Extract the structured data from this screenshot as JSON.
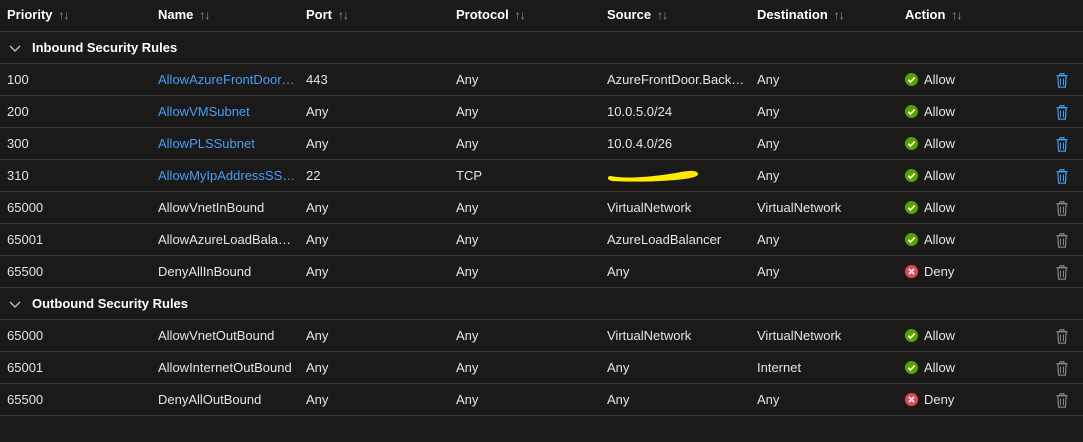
{
  "columns": {
    "priority": "Priority",
    "name": "Name",
    "port": "Port",
    "protocol": "Protocol",
    "source": "Source",
    "destination": "Destination",
    "action": "Action"
  },
  "colors": {
    "background": "#1b1a19",
    "link": "#479ef5",
    "allow": "#57a300",
    "deny": "#e74856",
    "delete_active": "#479ef5",
    "delete_disabled": "#8a8886",
    "redaction": "#ffea00"
  },
  "icons": {
    "sort": "sort-up-down-icon",
    "group_toggle": "chevron-down-icon",
    "allow": "checkmark-circle-icon",
    "deny": "dismiss-circle-icon",
    "delete": "trash-icon"
  },
  "inbound": {
    "label": "Inbound Security Rules",
    "rules": [
      {
        "priority": "100",
        "name": "AllowAzureFrontDoor…",
        "port": "443",
        "protocol": "Any",
        "source": "AzureFrontDoor.Backe…",
        "destination": "Any",
        "action": "Allow",
        "custom": true
      },
      {
        "priority": "200",
        "name": "AllowVMSubnet",
        "port": "Any",
        "protocol": "Any",
        "source": "10.0.5.0/24",
        "destination": "Any",
        "action": "Allow",
        "custom": true
      },
      {
        "priority": "300",
        "name": "AllowPLSSubnet",
        "port": "Any",
        "protocol": "Any",
        "source": "10.0.4.0/26",
        "destination": "Any",
        "action": "Allow",
        "custom": true
      },
      {
        "priority": "310",
        "name": "AllowMyIpAddressSSH…",
        "port": "22",
        "protocol": "TCP",
        "source": "",
        "destination": "Any",
        "action": "Allow",
        "custom": true,
        "redacted": true
      },
      {
        "priority": "65000",
        "name": "AllowVnetInBound",
        "port": "Any",
        "protocol": "Any",
        "source": "VirtualNetwork",
        "destination": "VirtualNetwork",
        "action": "Allow",
        "custom": false
      },
      {
        "priority": "65001",
        "name": "AllowAzureLoadBalanc…",
        "port": "Any",
        "protocol": "Any",
        "source": "AzureLoadBalancer",
        "destination": "Any",
        "action": "Allow",
        "custom": false
      },
      {
        "priority": "65500",
        "name": "DenyAllInBound",
        "port": "Any",
        "protocol": "Any",
        "source": "Any",
        "destination": "Any",
        "action": "Deny",
        "custom": false
      }
    ]
  },
  "outbound": {
    "label": "Outbound Security Rules",
    "rules": [
      {
        "priority": "65000",
        "name": "AllowVnetOutBound",
        "port": "Any",
        "protocol": "Any",
        "source": "VirtualNetwork",
        "destination": "VirtualNetwork",
        "action": "Allow",
        "custom": false
      },
      {
        "priority": "65001",
        "name": "AllowInternetOutBound",
        "port": "Any",
        "protocol": "Any",
        "source": "Any",
        "destination": "Internet",
        "action": "Allow",
        "custom": false
      },
      {
        "priority": "65500",
        "name": "DenyAllOutBound",
        "port": "Any",
        "protocol": "Any",
        "source": "Any",
        "destination": "Any",
        "action": "Deny",
        "custom": false
      }
    ]
  }
}
